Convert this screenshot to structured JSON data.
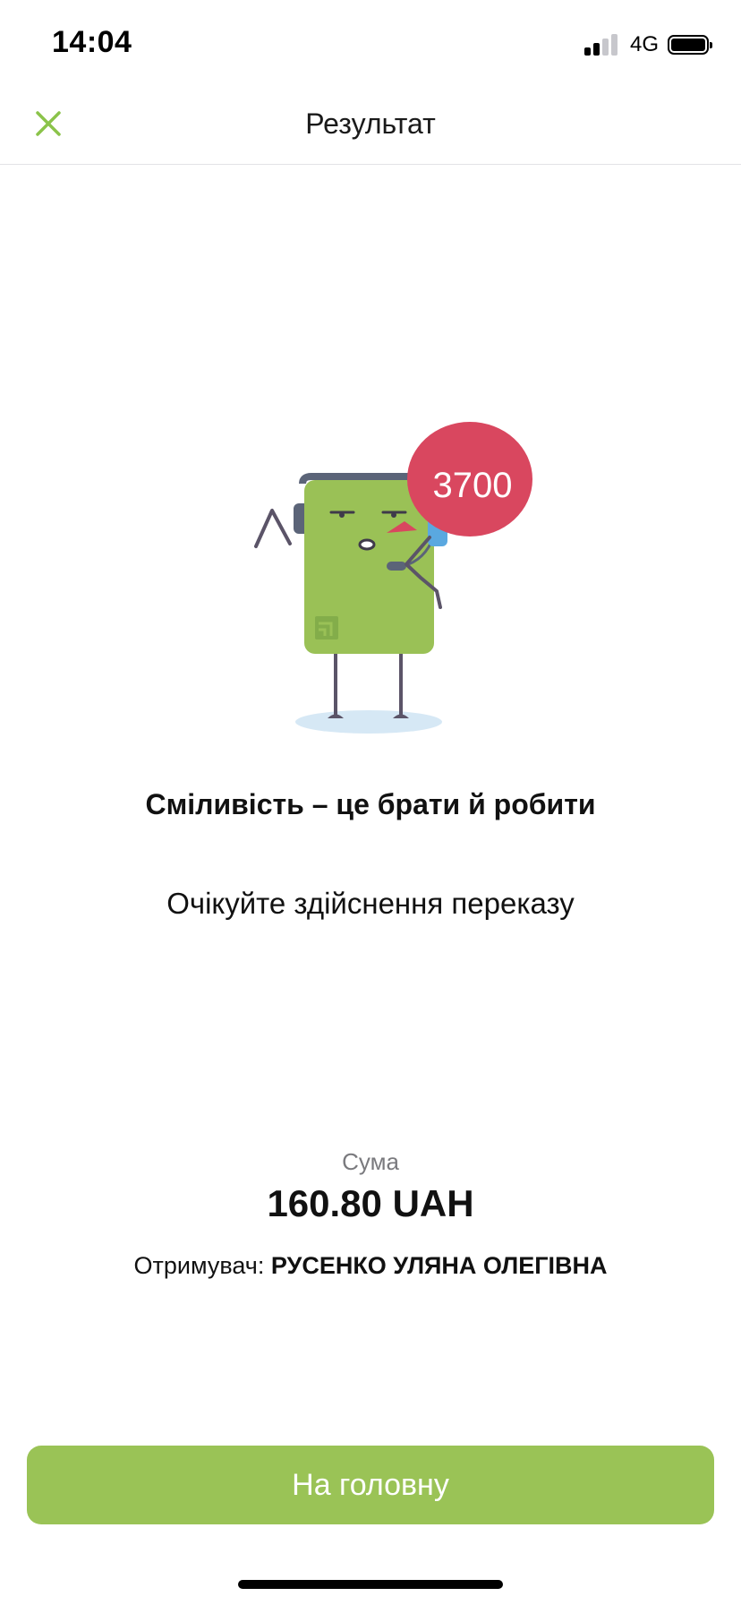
{
  "status_bar": {
    "time": "14:04",
    "network": "4G",
    "signal_bars_on": 2,
    "signal_bars_total": 4,
    "battery_level": 1.0
  },
  "nav": {
    "title": "Результат",
    "close_icon": "close-icon"
  },
  "illustration": {
    "bubble_count": "3700",
    "colors": {
      "card": "#9ac156",
      "bubble": "#d9475f",
      "limbs": "#5b5468",
      "shadow": "#d6e8f5",
      "headphone": "#5b6478",
      "phone": "#5aa8e0"
    }
  },
  "result": {
    "headline": "Сміливість – це брати й робити",
    "subline": "Очікуйте здійснення переказу",
    "amount_label": "Сума",
    "amount_value": "160.80 UAH",
    "recipient_label": "Отримувач:",
    "recipient_name": "РУСЕНКО УЛЯНА ОЛЕГІВНА"
  },
  "actions": {
    "home_button_label": "На головну"
  },
  "colors": {
    "accent": "#9ac356",
    "close_icon": "#8bc34a",
    "secondary_text": "#7a7a7e"
  }
}
